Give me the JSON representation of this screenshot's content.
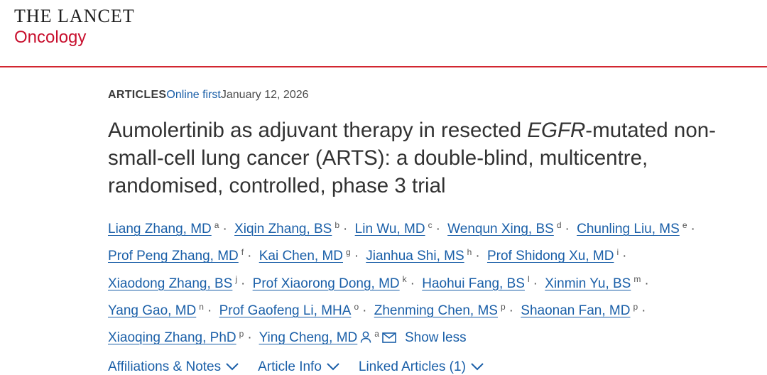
{
  "masthead": {
    "journal_top": "THE LANCET",
    "journal_bottom": "Oncology",
    "brand_color": "#c8102e"
  },
  "meta": {
    "type": "ARTICLES",
    "status": "Online first",
    "date": "January 12, 2026"
  },
  "title": {
    "part1": "Aumolertinib as adjuvant therapy in resected ",
    "italic": "EGFR",
    "part2": "-mutated non-small-cell lung cancer (ARTS): a double-blind, multicentre, randomised, controlled, phase 3 trial"
  },
  "authors": [
    {
      "name": "Liang Zhang, MD",
      "aff": "a"
    },
    {
      "name": "Xiqin Zhang, BS",
      "aff": "b"
    },
    {
      "name": "Lin Wu, MD",
      "aff": "c"
    },
    {
      "name": "Wenqun Xing, BS",
      "aff": "d"
    },
    {
      "name": "Chunling Liu, MS",
      "aff": "e"
    },
    {
      "name": "Prof Peng Zhang, MD",
      "aff": "f"
    },
    {
      "name": "Kai Chen, MD",
      "aff": "g"
    },
    {
      "name": "Jianhua Shi, MS",
      "aff": "h"
    },
    {
      "name": "Prof Shidong Xu, MD",
      "aff": "i"
    },
    {
      "name": "Xiaodong Zhang, BS",
      "aff": "j"
    },
    {
      "name": "Prof Xiaorong Dong, MD",
      "aff": "k"
    },
    {
      "name": "Haohui Fang, BS",
      "aff": "l"
    },
    {
      "name": "Xinmin Yu, BS",
      "aff": "m"
    },
    {
      "name": "Yang Gao, MD",
      "aff": "n"
    },
    {
      "name": "Prof Gaofeng Li, MHA",
      "aff": "o"
    },
    {
      "name": "Zhenming Chen, MS",
      "aff": "p"
    },
    {
      "name": "Shaonan Fan, MD",
      "aff": "p"
    },
    {
      "name": "Xiaoqing Zhang, PhD",
      "aff": "p"
    },
    {
      "name": "Ying Cheng, MD",
      "aff": "a"
    }
  ],
  "separator": "·",
  "corresponding_icon": "person-icon",
  "email_icon": "envelope-icon",
  "show_less": "Show less",
  "tabs": [
    {
      "label": "Affiliations & Notes"
    },
    {
      "label": "Article Info"
    },
    {
      "label": "Linked Articles (1)"
    }
  ],
  "link_color": "#1a5fa8"
}
